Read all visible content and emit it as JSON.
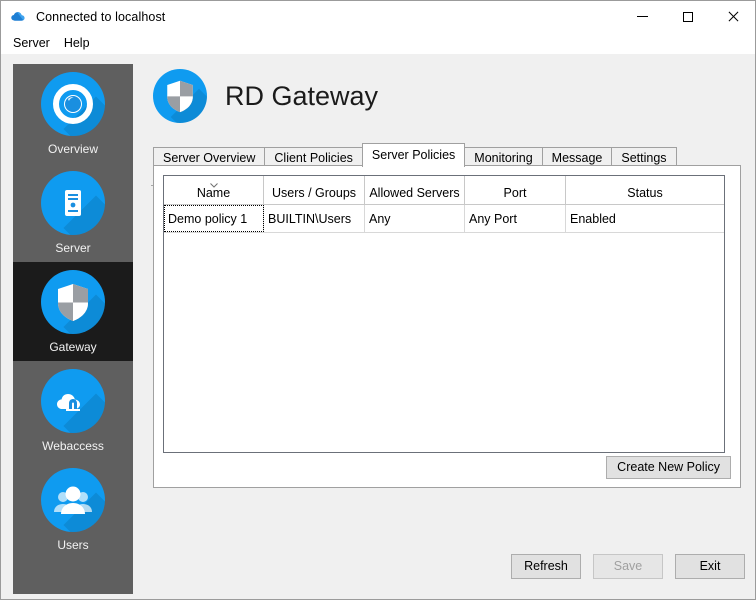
{
  "window": {
    "title": "Connected to localhost",
    "icon": "cloud-icon",
    "controls": {
      "minimize": "minimize-icon",
      "maximize": "maximize-icon",
      "close": "close-icon"
    }
  },
  "menu": {
    "items": [
      {
        "label": "Server"
      },
      {
        "label": "Help"
      }
    ]
  },
  "sidebar": {
    "items": [
      {
        "label": "Overview",
        "icon": "overview-ring-icon",
        "selected": false
      },
      {
        "label": "Server",
        "icon": "server-tower-icon",
        "selected": false
      },
      {
        "label": "Gateway",
        "icon": "shield-icon",
        "selected": true
      },
      {
        "label": "Webaccess",
        "icon": "cloud-arch-icon",
        "selected": false
      },
      {
        "label": "Users",
        "icon": "users-group-icon",
        "selected": false
      }
    ]
  },
  "page": {
    "title": "RD Gateway",
    "icon": "shield-icon"
  },
  "tabs": [
    {
      "label": "Server Overview",
      "active": false
    },
    {
      "label": "Client Policies",
      "active": false
    },
    {
      "label": "Server Policies",
      "active": true
    },
    {
      "label": "Monitoring",
      "active": false
    },
    {
      "label": "Message",
      "active": false
    },
    {
      "label": "Settings",
      "active": false
    }
  ],
  "grid": {
    "columns": [
      {
        "label": "Name",
        "sorted": true,
        "sort_direction": "descending"
      },
      {
        "label": "Users / Groups",
        "sorted": false,
        "sort_direction": ""
      },
      {
        "label": "Allowed Servers",
        "sorted": false,
        "sort_direction": ""
      },
      {
        "label": "Port",
        "sorted": false,
        "sort_direction": ""
      },
      {
        "label": "Status",
        "sorted": false,
        "sort_direction": ""
      }
    ],
    "rows": [
      {
        "name": "Demo policy 1",
        "users_groups": "BUILTIN\\Users",
        "allowed_servers": "Any",
        "port": "Any Port",
        "status": "Enabled",
        "focused_cell": "name"
      }
    ]
  },
  "actions": {
    "create_new_policy": "Create New Policy",
    "refresh": "Refresh",
    "save": "Save",
    "save_enabled": false,
    "exit": "Exit"
  },
  "colors": {
    "accent_blue": "#0f9bf0",
    "sidebar_bg": "#5f5f5f",
    "sidebar_selected_bg": "#1b1b1b",
    "window_bg": "#f0f0f0",
    "panel_bg": "#ffffff",
    "border": "#a0a0a0"
  }
}
